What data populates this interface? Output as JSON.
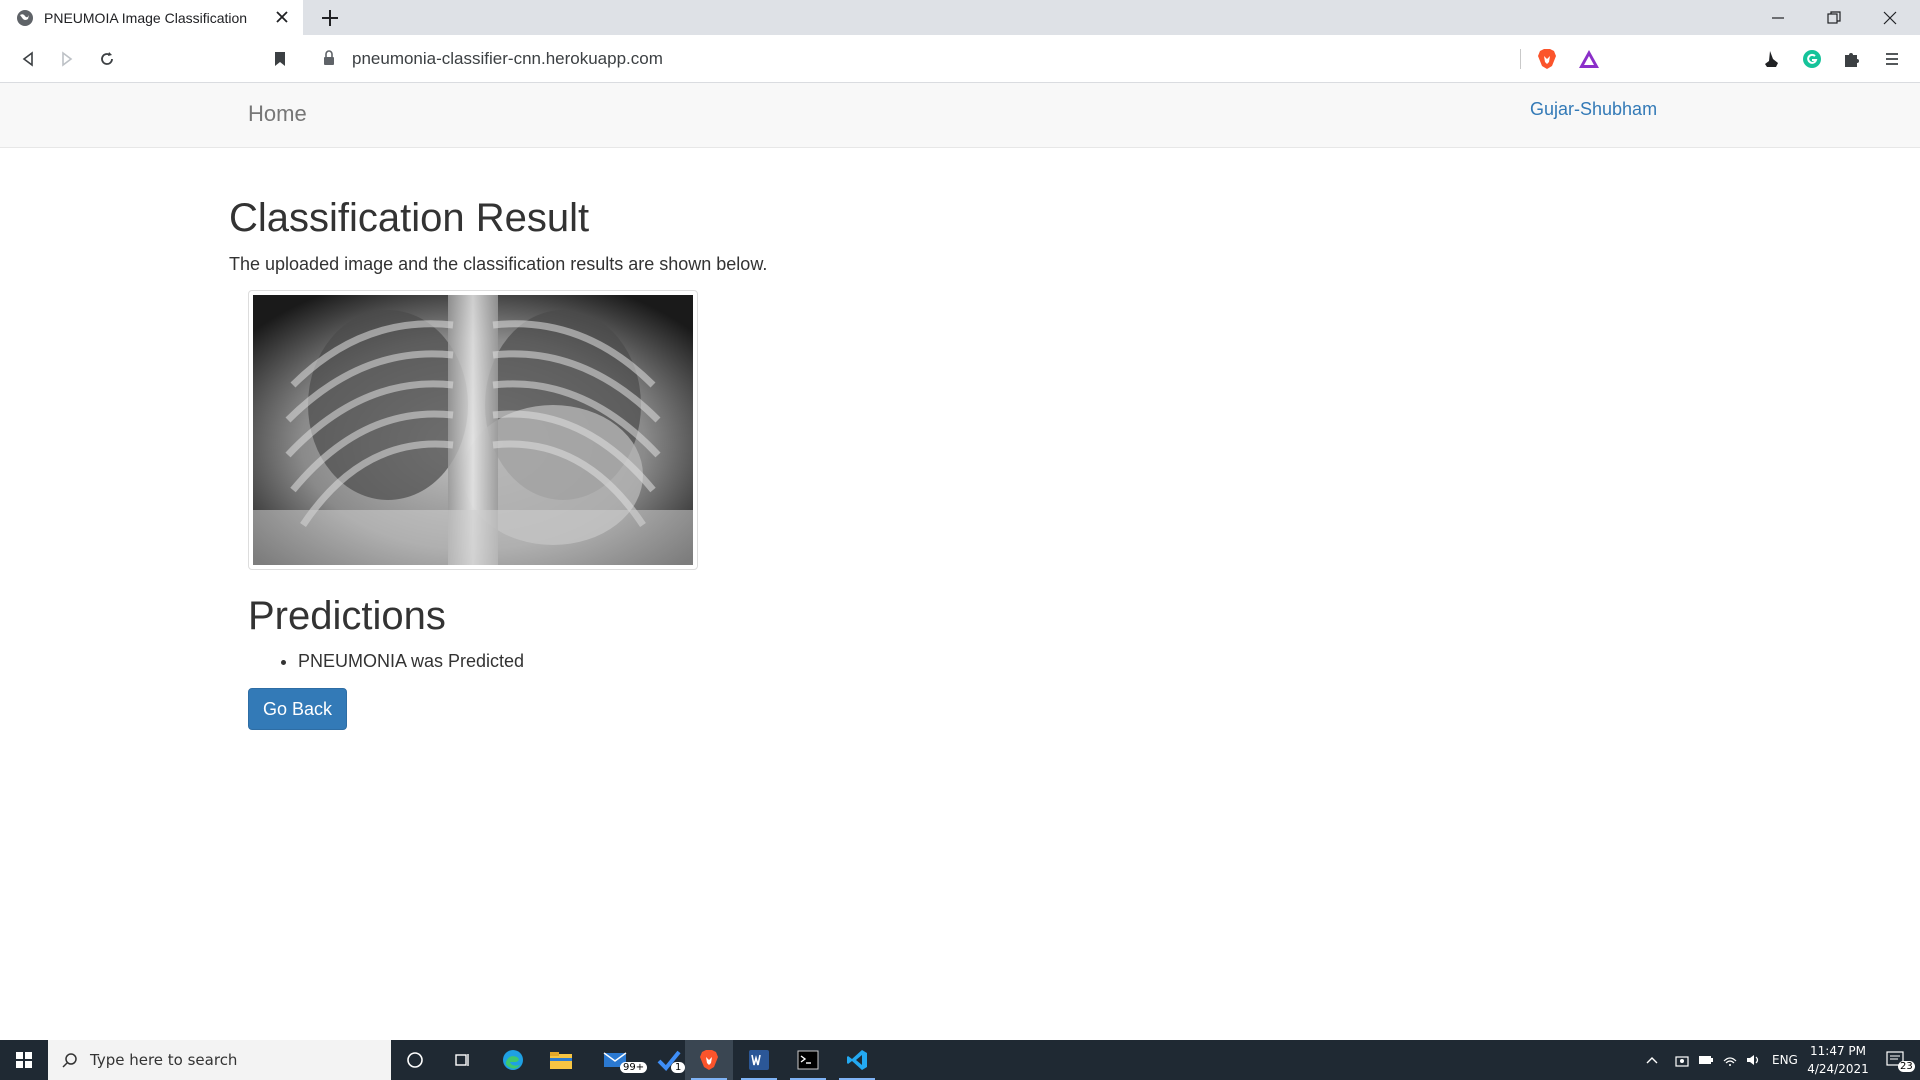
{
  "browser": {
    "tab_title": "PNEUMOIA Image Classification",
    "url": "pneumonia-classifier-cnn.herokuapp.com"
  },
  "navbar": {
    "home_label": "Home",
    "user_label": "Gujar-Shubham"
  },
  "main": {
    "title": "Classification Result",
    "description": "The uploaded image and the classification results are shown below.",
    "image_alt": "uploaded chest x-ray",
    "predictions_title": "Predictions",
    "predictions": [
      "PNEUMONIA was Predicted"
    ],
    "back_button_label": "Go Back"
  },
  "taskbar": {
    "search_placeholder": "Type here to search",
    "mail_badge": "99+",
    "todo_badge": "1",
    "language": "ENG",
    "time": "11:47 PM",
    "date": "4/24/2021",
    "notification_count": "23"
  },
  "colors": {
    "link": "#337ab7",
    "button": "#337ab7",
    "navbar_bg": "#f8f8f8",
    "taskbar_bg": "#1f2933"
  }
}
